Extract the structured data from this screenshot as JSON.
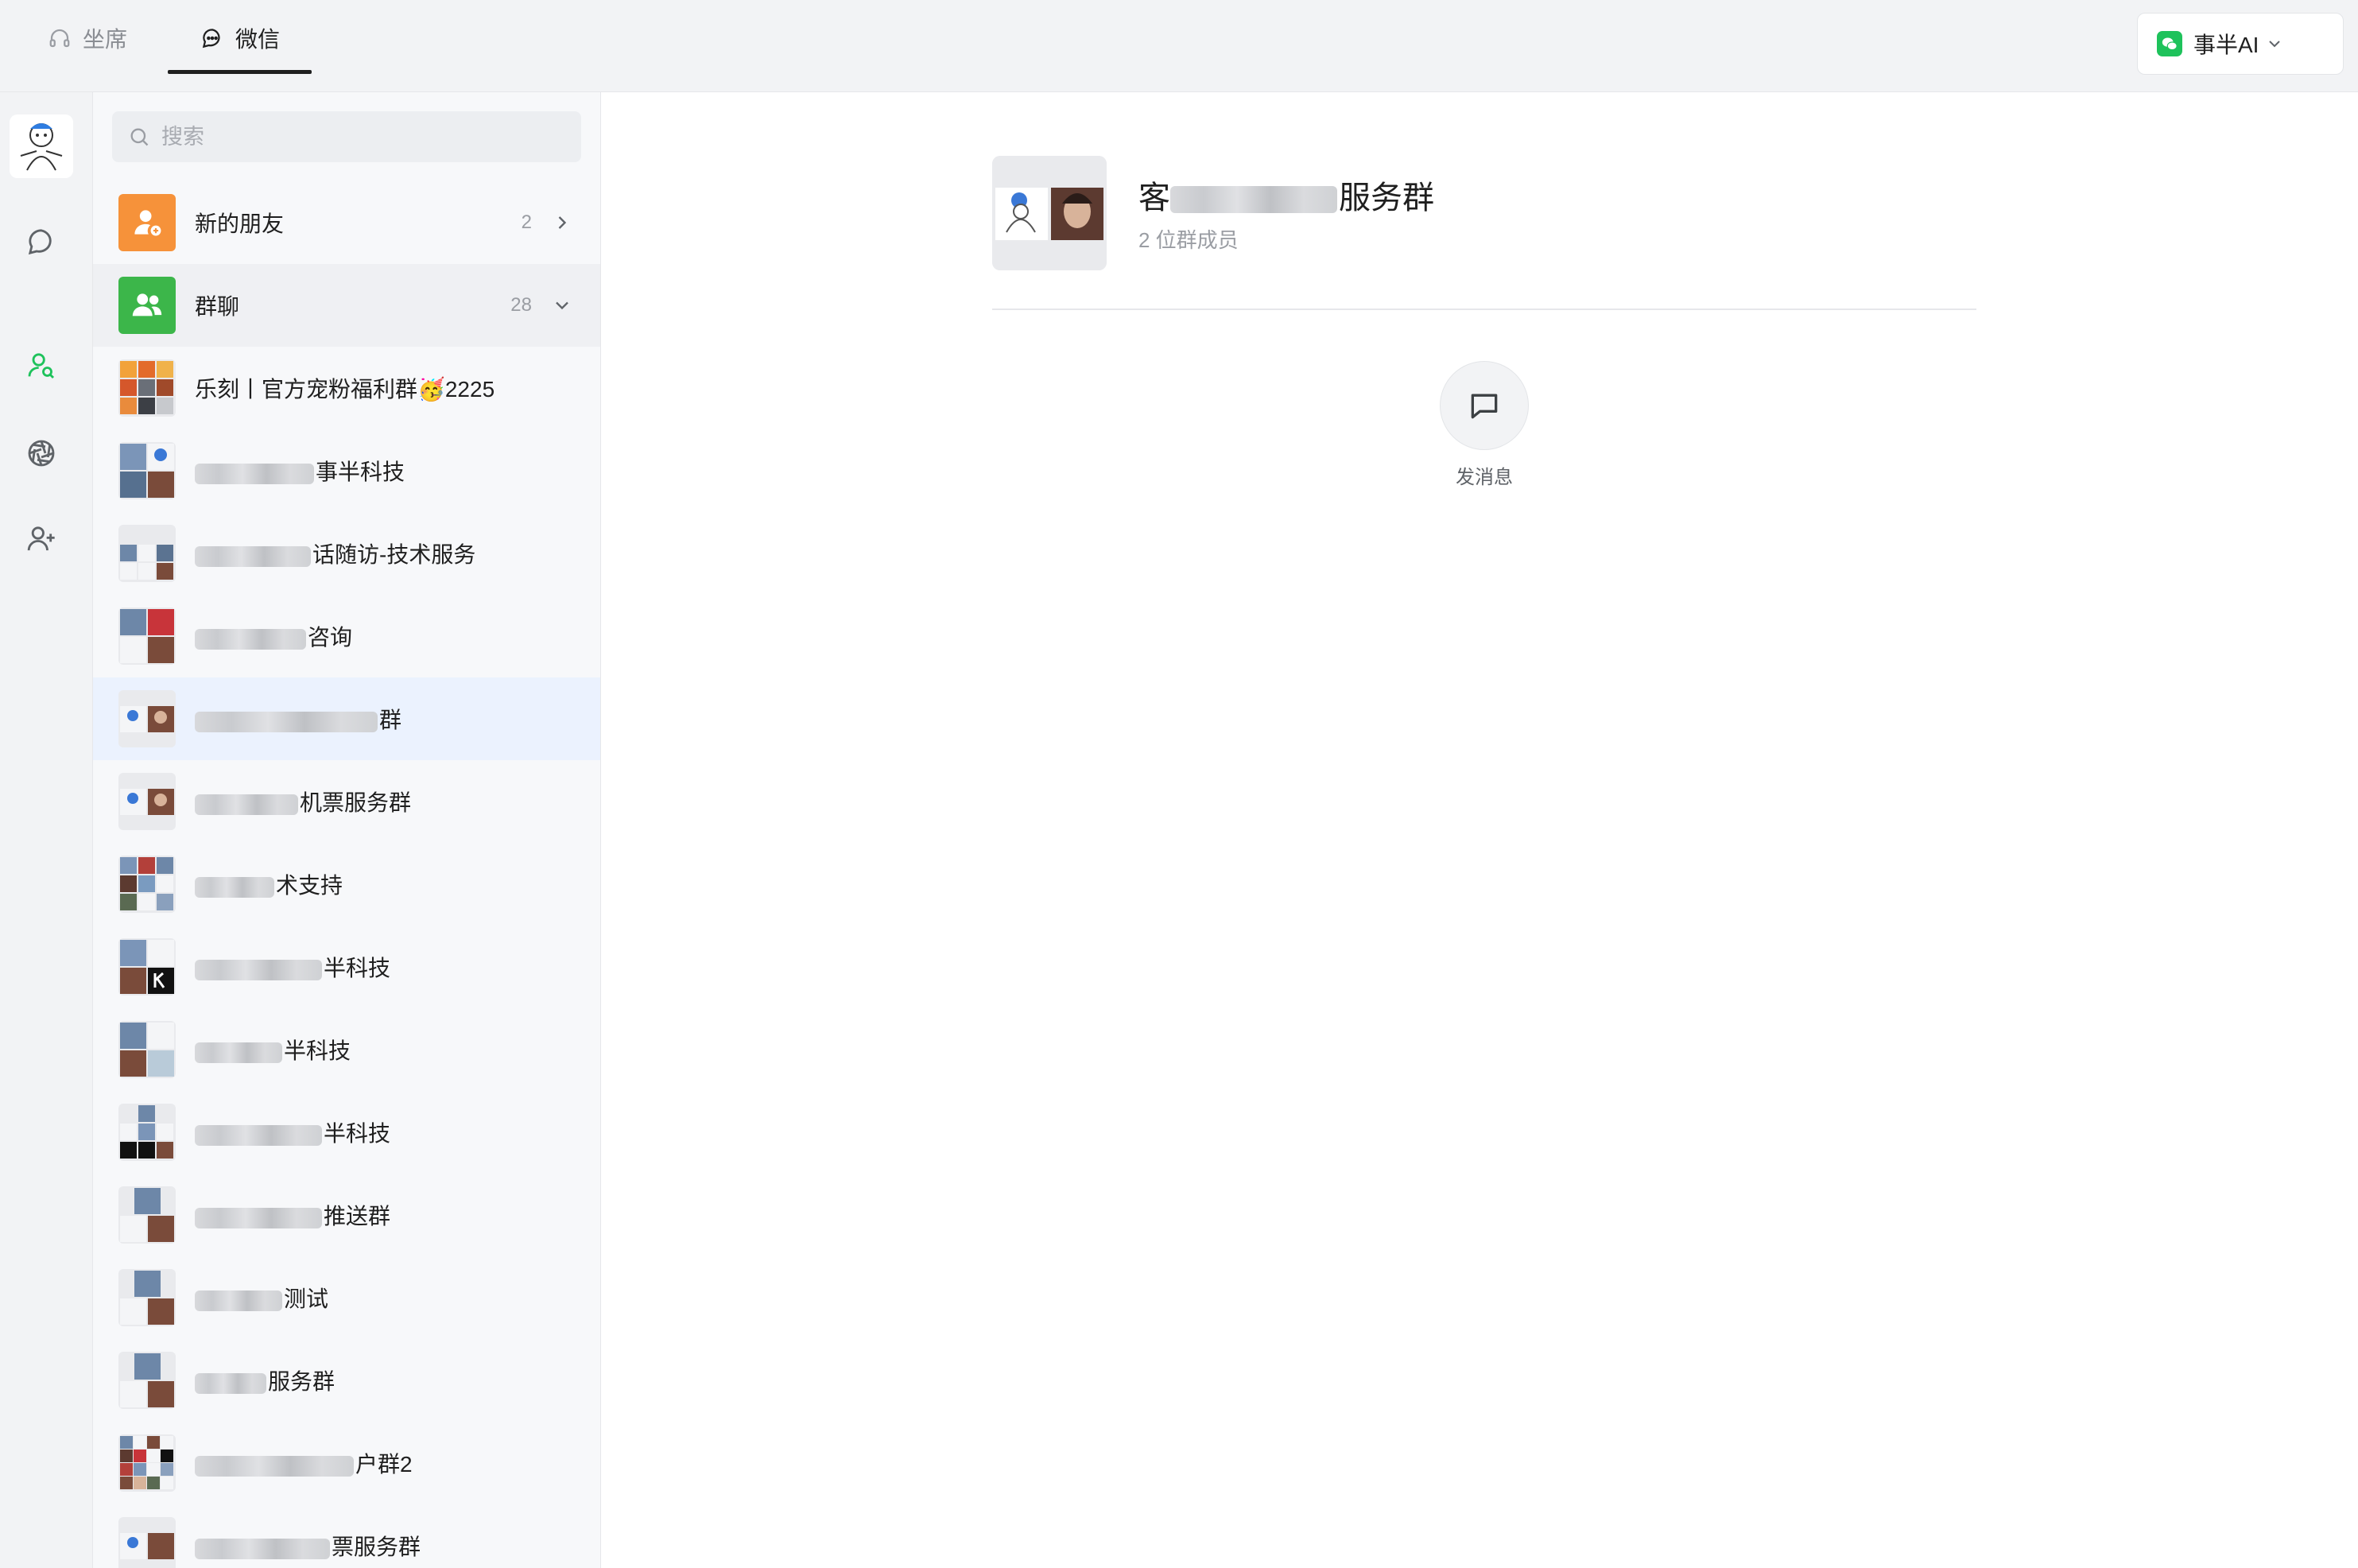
{
  "topbar": {
    "tabs": [
      {
        "label": "坐席",
        "icon": "headset-icon"
      },
      {
        "label": "微信",
        "icon": "chat-bubble-icon"
      }
    ],
    "account": {
      "label": "事半AI",
      "icon": "wechat-icon"
    }
  },
  "rail": {
    "icons": [
      "avatar",
      "chat-bubble-icon",
      "contacts-icon",
      "moments-icon",
      "add-friend-icon"
    ]
  },
  "search": {
    "placeholder": "搜索"
  },
  "list": {
    "new_friends": {
      "label": "新的朋友",
      "count": "2"
    },
    "groups_header": {
      "label": "群聊",
      "count": "28"
    },
    "groups": [
      {
        "visible": "乐刻丨官方宠粉福利群🥳2225"
      },
      {
        "visible": "事半科技"
      },
      {
        "visible": "话随访-技术服务"
      },
      {
        "visible": "咨询"
      },
      {
        "visible": "群"
      },
      {
        "visible": "机票服务群"
      },
      {
        "visible": "术支持"
      },
      {
        "visible": "半科技"
      },
      {
        "visible": "半科技"
      },
      {
        "visible": "半科技"
      },
      {
        "visible": "推送群"
      },
      {
        "visible": "测试"
      },
      {
        "visible": "服务群"
      },
      {
        "visible": "户群2"
      },
      {
        "visible": "票服务群"
      }
    ]
  },
  "detail": {
    "title_start": "客",
    "title_end": "服务群",
    "member_count": "2 位群成员",
    "send_label": "发消息"
  },
  "colors": {
    "accent_green": "#1ec25b",
    "new_friend_orange": "#f6923a",
    "group_green": "#3cb64a",
    "selected_row": "#ebf2fe"
  }
}
